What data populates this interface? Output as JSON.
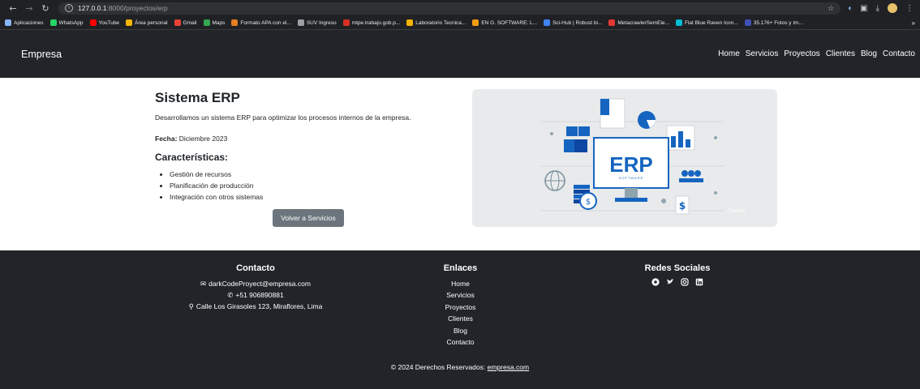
{
  "browser": {
    "url_host": "127.0.0.1",
    "url_rest": ":8000/proyectos/erp",
    "bookmarks": [
      "Aplicaciones",
      "WhatsApp",
      "YouTube",
      "Área personal",
      "Gmail",
      "Maps",
      "Formato APA con el...",
      "SUV Ingreso",
      "mtpe.trabajo.gob.p...",
      "Laboratorio Tecnica...",
      "EN G. SOFTWARE: L...",
      "Sci-Hub | Robust bi...",
      "MetacrawlerSemEle...",
      "Flat Blue Raven Icon...",
      "35.176+ Fotos y Im..."
    ],
    "bookmark_colors": [
      "#8ab4f8",
      "#25d366",
      "#ff0000",
      "#f4b400",
      "#ea4335",
      "#34a853",
      "#e67e22",
      "#9aa0a6",
      "#d93025",
      "#f4b400",
      "#f39c12",
      "#4285f4",
      "#e53935",
      "#00bcd4",
      "#3f51b5"
    ],
    "more": "»"
  },
  "navbar": {
    "brand": "Empresa",
    "links": [
      "Home",
      "Servicios",
      "Proyectos",
      "Clientes",
      "Blog",
      "Contacto"
    ]
  },
  "project": {
    "title": "Sistema ERP",
    "description": "Desarrollamos un sistema ERP para optimizar los procesos internos de la empresa.",
    "date_label": "Fecha:",
    "date_value": " Diciembre 2023",
    "features_title": "Características:",
    "features": [
      "Gestión de recursos",
      "Planificación de producción",
      "Integración con otros sistemas"
    ],
    "back_button": "Volver a Servicios",
    "image_text": "ERP",
    "image_subtext": "SOFTWARE",
    "image_caption": "Canva"
  },
  "footer": {
    "contact_title": "Contacto",
    "email": "darkCodeProyect@empresa.com",
    "phone": "+51 906890881",
    "address": "Calle Los Girasoles 123, Miraflores, Lima",
    "links_title": "Enlaces",
    "links": [
      "Home",
      "Servicios",
      "Proyectos",
      "Clientes",
      "Blog",
      "Contacto"
    ],
    "social_title": "Redes Sociales",
    "social_icons": [
      "github-icon",
      "twitter-icon",
      "instagram-icon",
      "linkedin-icon"
    ],
    "copyright_text": "© 2024 Derechos Reservados: ",
    "copyright_link": "empresa.com"
  },
  "colors": {
    "navbar_bg": "#212529",
    "button_bg": "#6c757d",
    "erp_blue": "#1565c0",
    "image_bg": "#e9eaeb"
  }
}
